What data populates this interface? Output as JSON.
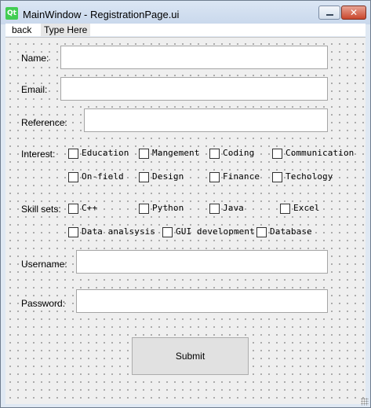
{
  "window": {
    "title": "MainWindow - RegistrationPage.ui",
    "icon": "qt-icon",
    "icon_text": "Qt"
  },
  "menubar": {
    "items": [
      "back",
      "Type Here"
    ]
  },
  "form": {
    "name_label": "Name:",
    "email_label": "Email:",
    "reference_label": "Reference:",
    "interest_label": "Interest:",
    "interests": [
      "Education",
      "Mangement",
      "Coding",
      "Communication",
      "On-field",
      "Design",
      "Finance",
      "Techology"
    ],
    "skills_label": "Skill sets:",
    "skills": [
      "C++",
      "Python",
      "Java",
      "Excel",
      "Data analsysis",
      "GUI development",
      "Database"
    ],
    "username_label": "Username:",
    "password_label": "Password:",
    "submit_label": "Submit"
  }
}
